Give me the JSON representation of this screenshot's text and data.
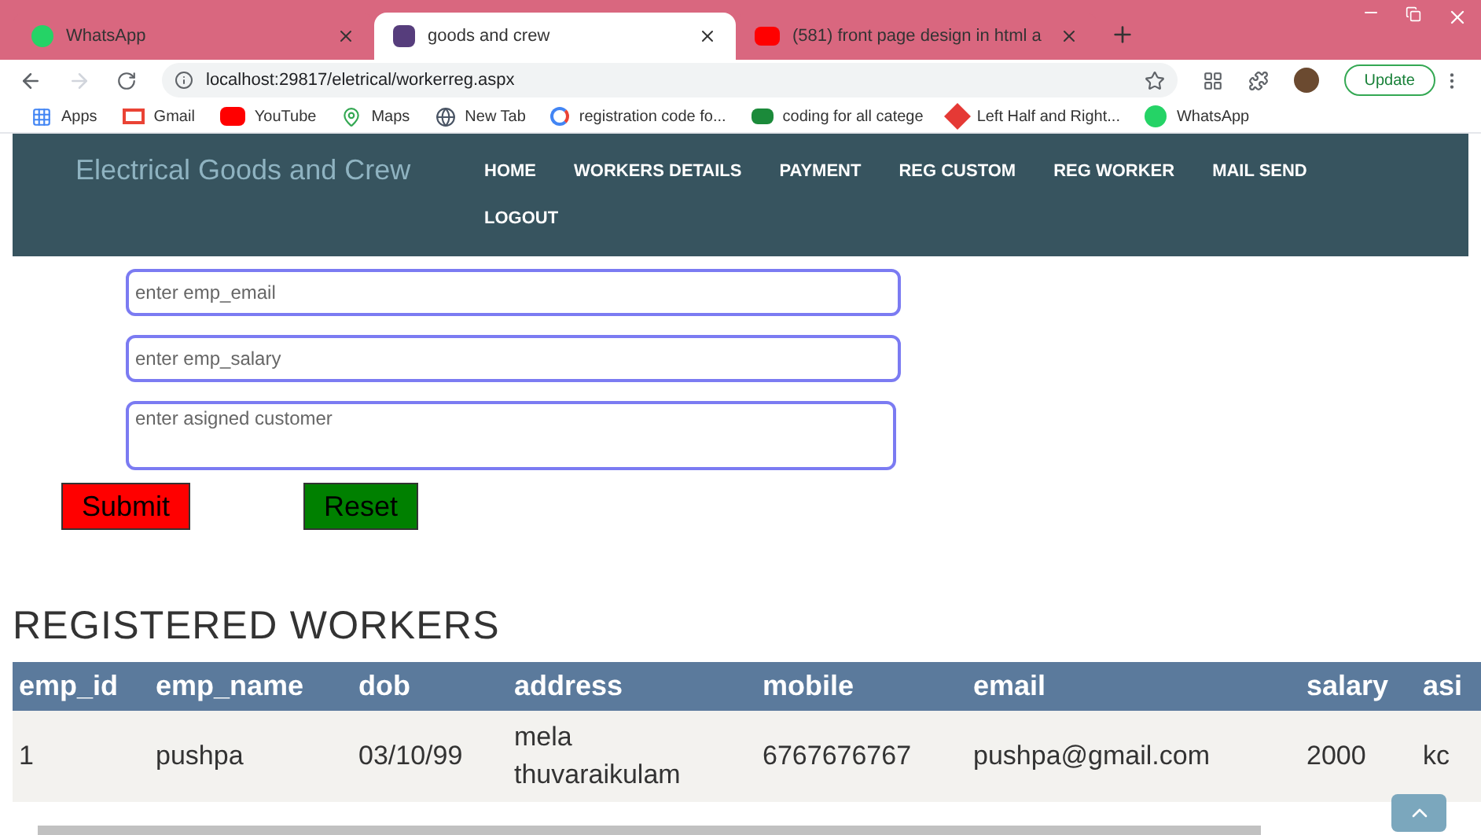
{
  "browser": {
    "tabs": [
      {
        "title": "WhatsApp",
        "selected": false
      },
      {
        "title": "goods and crew",
        "selected": true
      },
      {
        "title": "(581) front page design in html a",
        "selected": false
      }
    ],
    "address": "localhost:29817/eletrical/workerreg.aspx",
    "update_button": "Update",
    "bookmarks": [
      "Apps",
      "Gmail",
      "YouTube",
      "Maps",
      "New Tab",
      "registration code fo...",
      "coding for all catege",
      "Left Half and Right...",
      "WhatsApp"
    ]
  },
  "header": {
    "brand": "Electrical Goods and Crew",
    "nav": [
      "HOME",
      "WORKERS DETAILS",
      "PAYMENT",
      "REG CUSTOM",
      "REG WORKER",
      "MAIL SEND",
      "LOGOUT"
    ]
  },
  "form": {
    "fields": [
      {
        "placeholder": "enter emp_email",
        "kind": "input"
      },
      {
        "placeholder": "enter emp_salary",
        "kind": "input"
      },
      {
        "placeholder": "enter asigned customer",
        "kind": "textarea"
      }
    ],
    "buttons": [
      {
        "label": "Submit",
        "color": "#ff0000"
      },
      {
        "label": "Reset",
        "color": "#008000"
      }
    ]
  },
  "table": {
    "title": "REGISTERED WORKERS",
    "columns": [
      "emp_id",
      "emp_name",
      "dob",
      "address",
      "mobile",
      "email",
      "salary",
      "asi"
    ],
    "rows": [
      [
        "1",
        "pushpa",
        "03/10/99",
        "mela thuvaraikulam",
        "6767676767",
        "pushpa@gmail.com",
        "2000",
        "kc"
      ]
    ]
  }
}
